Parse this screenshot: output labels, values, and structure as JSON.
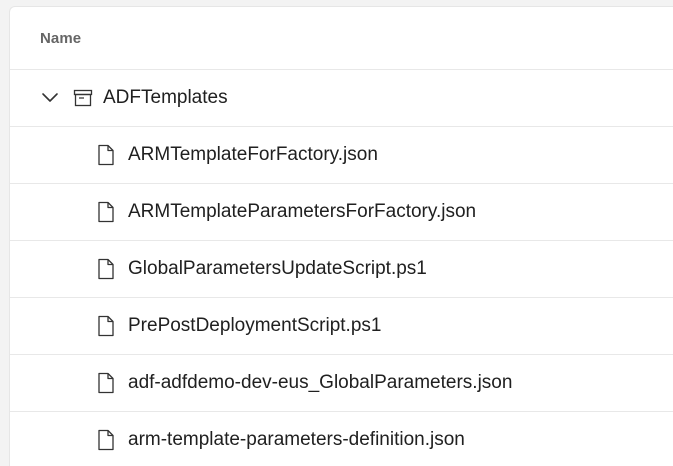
{
  "table": {
    "header": {
      "name_label": "Name"
    },
    "folder": {
      "name": "ADFTemplates",
      "expanded": true
    },
    "files": [
      {
        "name": "ARMTemplateForFactory.json"
      },
      {
        "name": "ARMTemplateParametersForFactory.json"
      },
      {
        "name": "GlobalParametersUpdateScript.ps1"
      },
      {
        "name": "PrePostDeploymentScript.ps1"
      },
      {
        "name": "adf-adfdemo-dev-eus_GlobalParameters.json"
      },
      {
        "name": "arm-template-parameters-definition.json"
      }
    ]
  },
  "icons": {
    "expand": "chevron-down-icon",
    "folder": "repo-folder-icon",
    "file": "document-icon"
  }
}
